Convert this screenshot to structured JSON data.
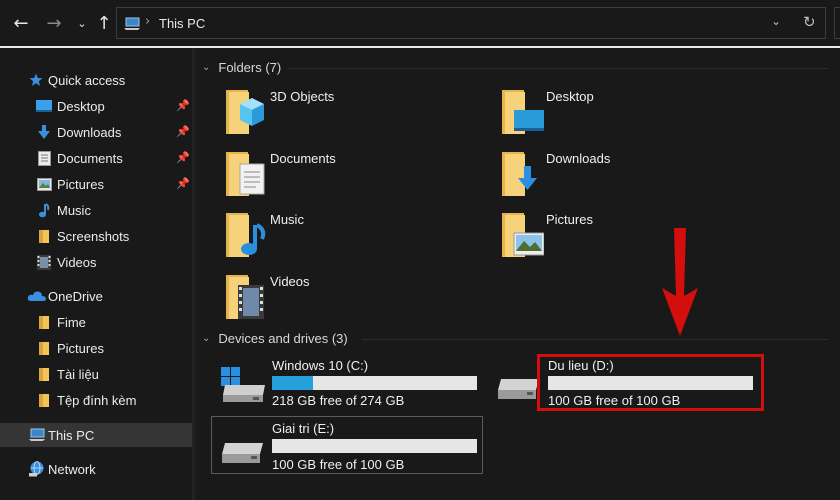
{
  "toolbar": {
    "back_icon": "back-arrow-icon",
    "forward_icon": "forward-arrow-icon",
    "recent_icon": "chevron-down-icon",
    "up_icon": "up-arrow-icon",
    "breadcrumb": "This PC",
    "dropdown_icon": "chevron-down-icon",
    "refresh_icon": "refresh-icon"
  },
  "sidebar": {
    "items": [
      {
        "label": "Quick access",
        "icon": "star-icon",
        "pinned": false
      },
      {
        "label": "Desktop",
        "icon": "desktop-icon",
        "pinned": true
      },
      {
        "label": "Downloads",
        "icon": "download-icon",
        "pinned": true
      },
      {
        "label": "Documents",
        "icon": "document-icon",
        "pinned": true
      },
      {
        "label": "Pictures",
        "icon": "pictures-icon",
        "pinned": true
      },
      {
        "label": "Music",
        "icon": "music-icon",
        "pinned": false
      },
      {
        "label": "Screenshots",
        "icon": "folder-icon",
        "pinned": false
      },
      {
        "label": "Videos",
        "icon": "videos-icon",
        "pinned": false
      },
      {
        "label": "OneDrive",
        "icon": "cloud-icon",
        "pinned": false
      },
      {
        "label": "Fime",
        "icon": "folder-icon",
        "pinned": false
      },
      {
        "label": "Pictures",
        "icon": "folder-icon",
        "pinned": false
      },
      {
        "label": "Tài liệu",
        "icon": "folder-icon",
        "pinned": false
      },
      {
        "label": "Tệp đính kèm",
        "icon": "folder-icon",
        "pinned": false
      },
      {
        "label": "This PC",
        "icon": "computer-icon",
        "pinned": false,
        "selected": true
      },
      {
        "label": "Network",
        "icon": "network-icon",
        "pinned": false
      }
    ]
  },
  "folders": {
    "header": "Folders (7)",
    "items": [
      {
        "name": "3D Objects",
        "icon": "3d-objects-icon"
      },
      {
        "name": "Desktop",
        "icon": "desktop-folder-icon"
      },
      {
        "name": "Documents",
        "icon": "documents-folder-icon"
      },
      {
        "name": "Downloads",
        "icon": "downloads-folder-icon"
      },
      {
        "name": "Music",
        "icon": "music-folder-icon"
      },
      {
        "name": "Pictures",
        "icon": "pictures-folder-icon"
      },
      {
        "name": "Videos",
        "icon": "videos-folder-icon"
      }
    ]
  },
  "drives": {
    "header": "Devices and drives (3)",
    "items": [
      {
        "name": "Windows 10 (C:)",
        "free_text": "218 GB free of 274 GB",
        "used_fraction": 0.2,
        "icon": "system-drive-icon"
      },
      {
        "name": "Du lieu (D:)",
        "free_text": "100 GB free of 100 GB",
        "used_fraction": 0.0,
        "icon": "hard-drive-icon"
      },
      {
        "name": "Giai tri (E:)",
        "free_text": "100 GB free of 100 GB",
        "used_fraction": 0.0,
        "icon": "hard-drive-icon"
      }
    ]
  },
  "annotation": {
    "highlight_color": "#d40d0d",
    "highlighted_drive": "Du lieu (D:)"
  },
  "colors": {
    "background": "#191919",
    "accent": "#26a0da",
    "folder": "#f2c45a"
  }
}
